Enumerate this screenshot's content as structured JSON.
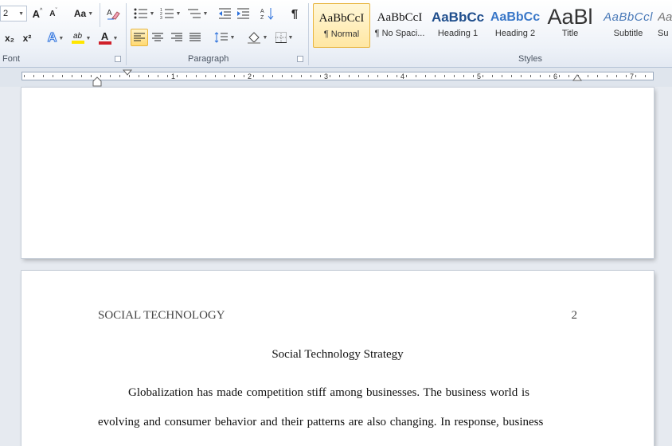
{
  "ribbon": {
    "font": {
      "label": "Font",
      "size_value": "2",
      "grow_label": "A",
      "shrink_label": "A",
      "change_case_label": "Aa",
      "subscript_label": "x₂",
      "superscript_label": "x²",
      "text_effects_label": "A",
      "highlight_label": "ab",
      "font_color_label": "A"
    },
    "paragraph": {
      "label": "Paragraph",
      "show_marks_label": "¶"
    },
    "styles": {
      "label": "Styles",
      "items": [
        {
          "preview": "AaBbCcI",
          "name": "¶ Normal"
        },
        {
          "preview": "AaBbCcI",
          "name": "¶ No Spaci..."
        },
        {
          "preview": "AaBbCc",
          "name": "Heading 1"
        },
        {
          "preview": "AaBbCc",
          "name": "Heading 2"
        },
        {
          "preview": "AaBl",
          "name": "Title"
        },
        {
          "preview": "AaBbCcl",
          "name": "Subtitle"
        },
        {
          "preview": "Aa",
          "name": "Su"
        }
      ]
    }
  },
  "ruler": {
    "numbers": [
      "1",
      "2",
      "3",
      "4",
      "5",
      "6",
      "7"
    ]
  },
  "document": {
    "header_left": "SOCIAL TECHNOLOGY",
    "page_number": "2",
    "title": "Social Technology Strategy",
    "paragraph_line1": "Globalization has made competition stiff among businesses. The business world is",
    "paragraph_line2": "evolving and consumer behavior and their patterns are also changing. In response, business"
  },
  "colors": {
    "accent_blue": "#2a6fdb",
    "highlight_yellow": "#ffe600",
    "font_red": "#d0202a",
    "active_style_border": "#e8b53f"
  }
}
